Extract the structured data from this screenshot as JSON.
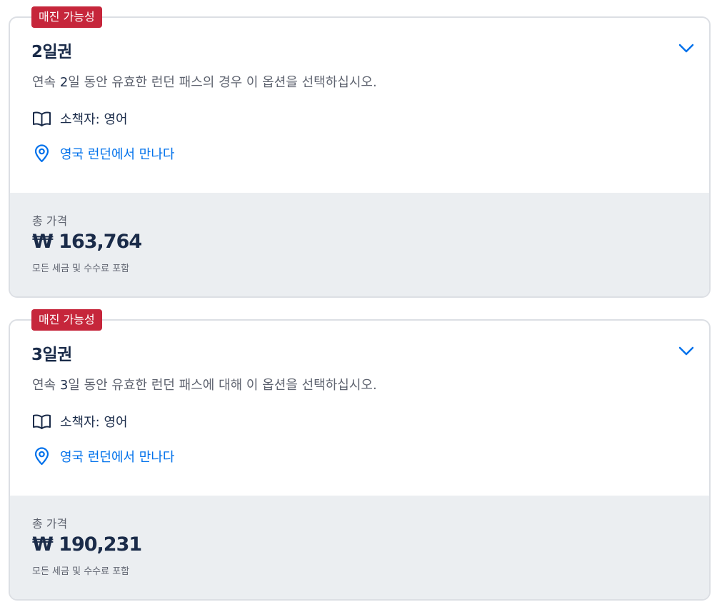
{
  "options": [
    {
      "badge": "매진 가능성",
      "title": "2일권",
      "desc_before": "연속 ",
      "desc_num": "2",
      "desc_after": "일 동안 유효한 런던 패스의 경우 이 옵션을 선택하십시오.",
      "language": "소책자: 영어",
      "meeting": "영국 런던에서 만나다",
      "price_label": "총 가격",
      "price": "₩ 163,764",
      "price_note": "모든 세금 및 수수료 포함"
    },
    {
      "badge": "매진 가능성",
      "title": "3일권",
      "desc_before": "연속 ",
      "desc_num": "3",
      "desc_after": "일 동안 유효한 런던 패스에 대해 이 옵션을 선택하십시오.",
      "language": "소책자: 영어",
      "meeting": "영국 런던에서 만나다",
      "price_label": "총 가격",
      "price": "₩ 190,231",
      "price_note": "모든 세금 및 수수료 포함"
    }
  ],
  "icons": {
    "expand": "chevron-down-icon",
    "language": "book-icon",
    "meeting": "location-pin-icon"
  },
  "colors": {
    "badge": "#c6263b",
    "link": "#0071eb",
    "text": "#1a2b49",
    "price_panel": "#ebeef1"
  }
}
